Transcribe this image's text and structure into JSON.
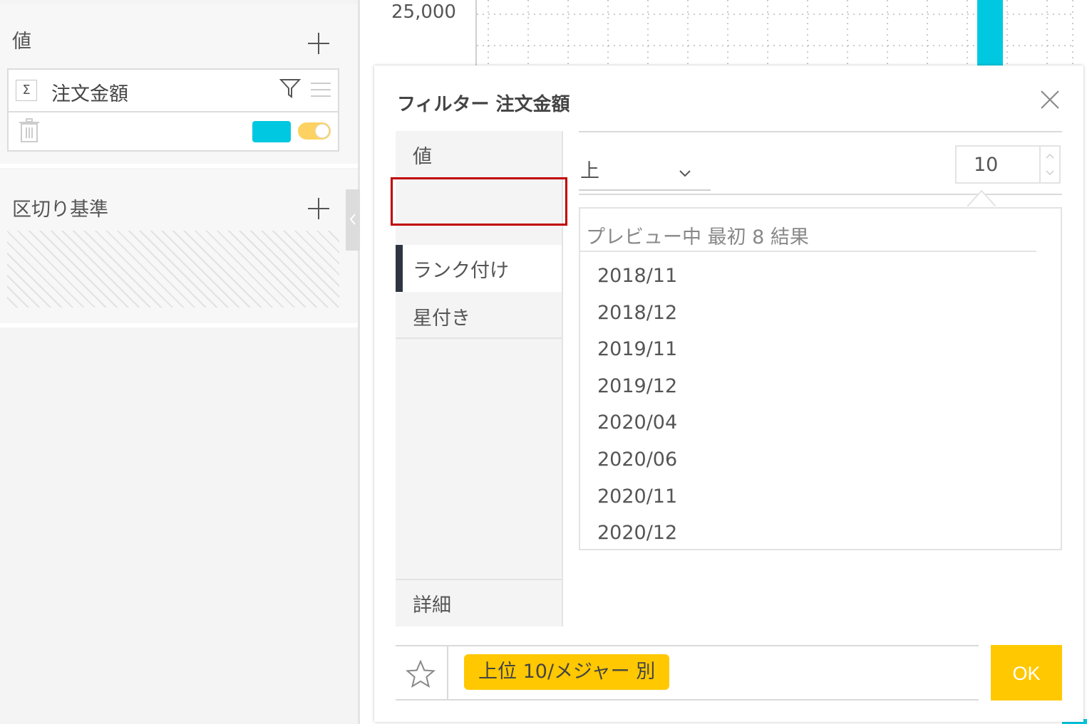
{
  "left_panel": {
    "values_title": "値",
    "field": {
      "sigma": "Σ",
      "name": "注文金額"
    },
    "breakdown_title": "区切り基準"
  },
  "chart": {
    "y_tick": "25,000"
  },
  "dialog": {
    "title": "フィルター 注文金額",
    "tabs": [
      {
        "label": "値"
      },
      {
        "label": "ランク付け"
      },
      {
        "label": "星付き"
      },
      {
        "label": "詳細"
      }
    ],
    "rank_direction": "上",
    "rank_count": "10",
    "preview_header": "プレビュー中 最初 8 結果",
    "preview_items": [
      "2018/11",
      "2018/12",
      "2019/11",
      "2019/12",
      "2020/04",
      "2020/06",
      "2020/11",
      "2020/12"
    ],
    "summary": "上位 10/メジャー 別",
    "ok_label": "OK"
  },
  "colors": {
    "accent_cyan": "#00c8e0",
    "accent_yellow": "#ffc800",
    "highlight_red": "#c00000",
    "active_tab_bar": "#2e3540"
  },
  "icons": [
    "plus-icon",
    "sigma-icon",
    "filter-icon",
    "menu-icon",
    "trash-icon",
    "chevron-left-icon",
    "close-icon",
    "chevron-down-icon",
    "chevron-up-icon",
    "star-icon"
  ]
}
